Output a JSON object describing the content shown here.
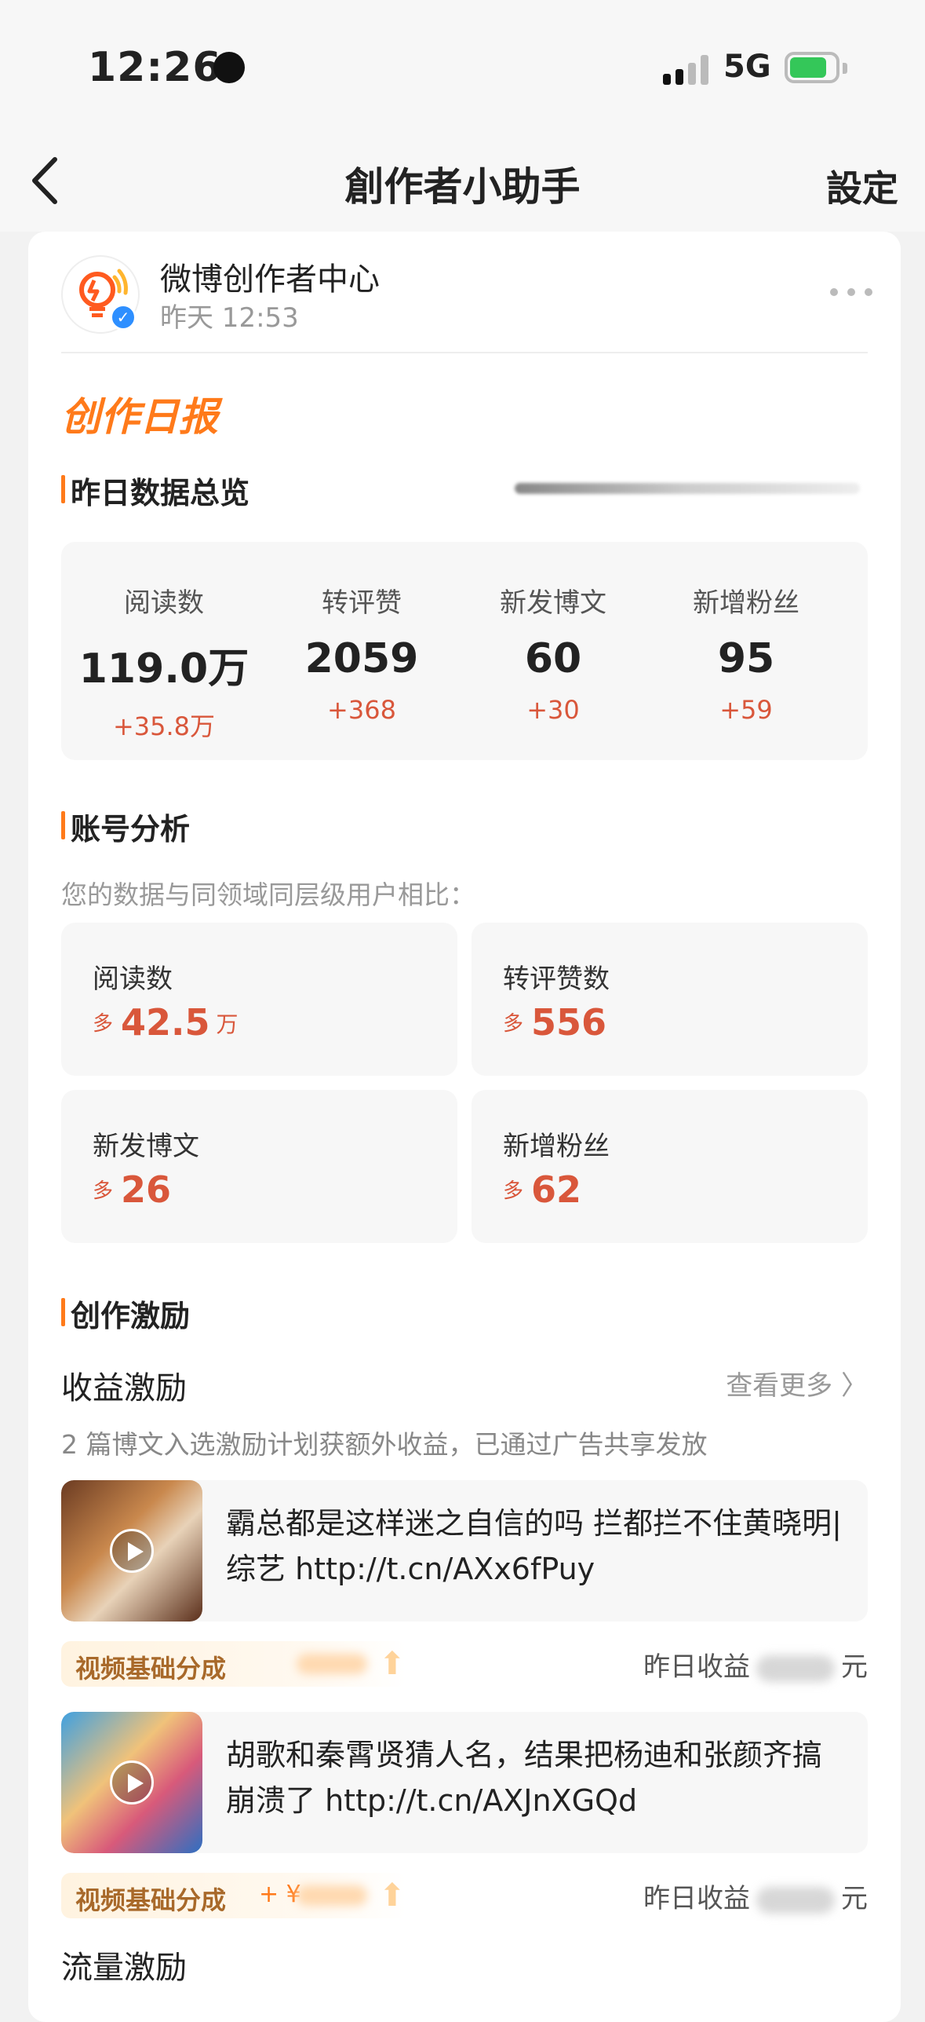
{
  "status_bar": {
    "time": "12:26",
    "network": "5G"
  },
  "nav": {
    "title": "創作者小助手",
    "settings": "設定"
  },
  "message": {
    "sender": "微博创作者中心",
    "time": "昨天 12:53"
  },
  "report": {
    "title": "创作日报",
    "overview": {
      "title": "昨日数据总览",
      "stats": [
        {
          "label": "阅读数",
          "value": "119.0万",
          "delta": "+35.8万"
        },
        {
          "label": "转评赞",
          "value": "2059",
          "delta": "+368"
        },
        {
          "label": "新发博文",
          "value": "60",
          "delta": "+30"
        },
        {
          "label": "新增粉丝",
          "value": "95",
          "delta": "+59"
        }
      ]
    },
    "analysis": {
      "title": "账号分析",
      "note": "您的数据与同领域同层级用户相比：",
      "items": [
        {
          "label": "阅读数",
          "prefix": "多",
          "value": "42.5",
          "unit": "万"
        },
        {
          "label": "转评赞数",
          "prefix": "多",
          "value": "556",
          "unit": ""
        },
        {
          "label": "新发博文",
          "prefix": "多",
          "value": "26",
          "unit": ""
        },
        {
          "label": "新增粉丝",
          "prefix": "多",
          "value": "62",
          "unit": ""
        }
      ]
    },
    "incentive": {
      "title": "创作激励",
      "income_title": "收益激励",
      "see_more": "查看更多 〉",
      "note": "2 篇博文入选激励计划获额外收益，已通过广告共享发放",
      "posts": [
        {
          "text": "霸总都是这样迷之自信的吗 拦都拦不住黄晓明|综艺 http://t.cn/AXx6fPuy",
          "reward_label": "视频基础分成",
          "reward_amount": "",
          "yesterday_label": "昨日收益",
          "currency": "元"
        },
        {
          "text": "胡歌和秦霄贤猜人名，结果把杨迪和张颜齐搞崩溃了 http://t.cn/AXJnXGQd",
          "reward_label": "视频基础分成",
          "reward_amount": "+ ¥",
          "yesterday_label": "昨日收益",
          "currency": "元"
        }
      ],
      "flow_title": "流量激励"
    }
  },
  "colors": {
    "accent": "#ff7a1a",
    "increase": "#d9573b",
    "verified": "#2e8fff"
  }
}
